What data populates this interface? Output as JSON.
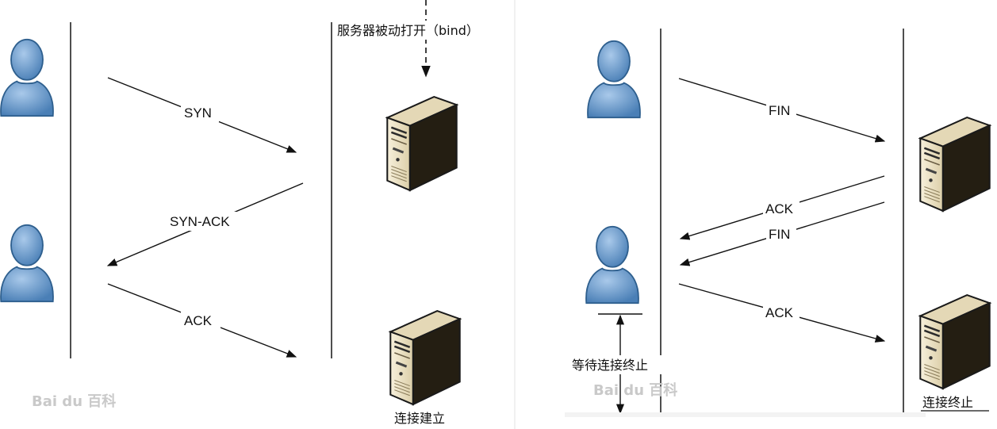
{
  "left_panel": {
    "server_annotation": "服务器被动打开（bind）",
    "arrows": [
      "SYN",
      "SYN-ACK",
      "ACK"
    ],
    "server_caption": "连接建立"
  },
  "right_panel": {
    "arrows": [
      "FIN",
      "ACK",
      "FIN",
      "ACK"
    ],
    "client_wait_label": "等待连接终止",
    "server_caption": "连接终止"
  },
  "watermark": "Bai du 百科",
  "colors": {
    "person_fill": "#5f93c8",
    "person_stroke": "#2e5f8e",
    "server_light": "#efe5cb",
    "server_dark": "#2f2818",
    "arrow": "#111111"
  }
}
